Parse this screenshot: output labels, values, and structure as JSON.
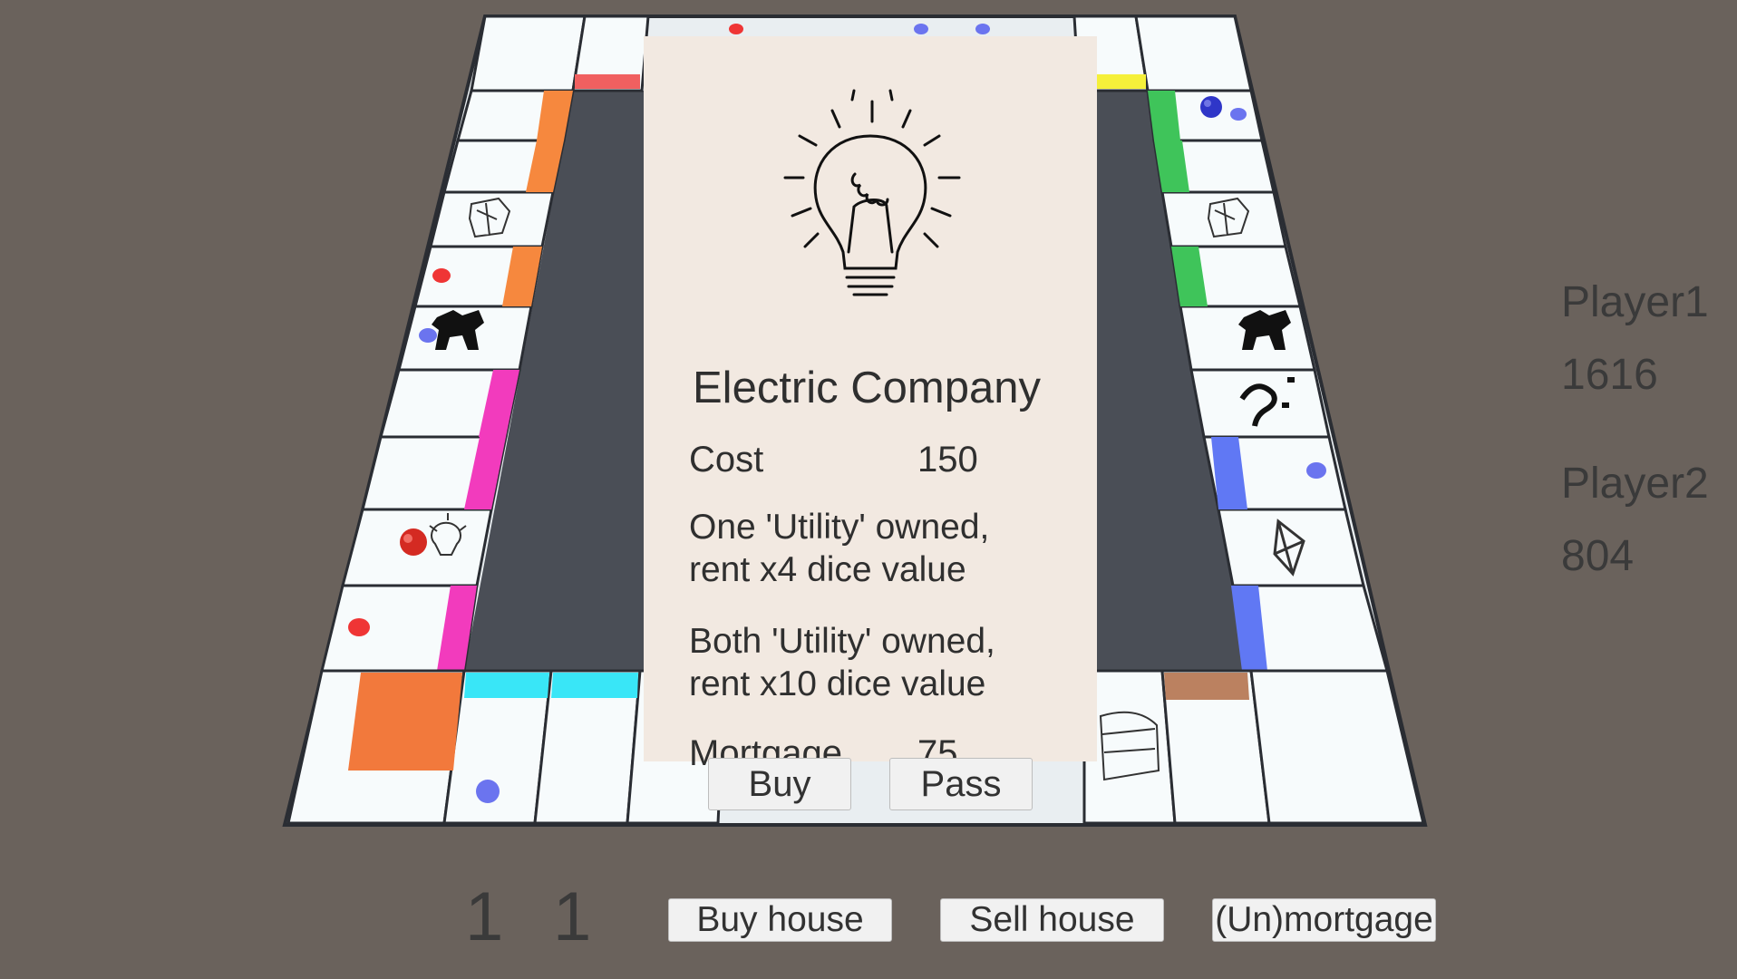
{
  "card": {
    "title": "Electric Company",
    "icon": "lightbulb-icon",
    "cost_label": "Cost",
    "cost_value": "150",
    "rule_one_line1": "One 'Utility' owned,",
    "rule_one_line2": "rent x4 dice value",
    "rule_both_line1": "Both 'Utility' owned,",
    "rule_both_line2": "rent x10 dice value",
    "mortgage_label": "Mortgage",
    "mortgage_value": "75",
    "buy_label": "Buy",
    "pass_label": "Pass"
  },
  "players": [
    {
      "name": "Player1",
      "money": "1616"
    },
    {
      "name": "Player2",
      "money": "804"
    }
  ],
  "dice": [
    "1",
    "1"
  ],
  "actions": {
    "buy_house": "Buy house",
    "sell_house": "Sell house",
    "mortgage": "(Un)mortgage"
  },
  "colors": {
    "background": "#6a625c",
    "card": "#f2e9e1",
    "board_center": "#4a4e56",
    "tile": "#f7fbfc",
    "player1_token": "#d42a22",
    "player2_token": "#2f36c8"
  }
}
